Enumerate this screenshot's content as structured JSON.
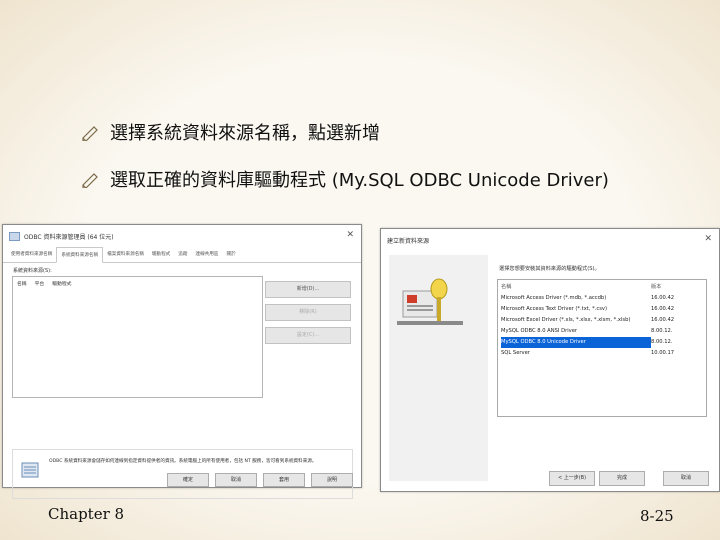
{
  "slide": {
    "bullets": [
      "選擇系統資料來源名稱，點選新增",
      "選取正確的資料庫驅動程式 (My.SQL ODBC Unicode Driver)"
    ],
    "footer_left": "Chapter 8",
    "footer_right": "8-25"
  },
  "odbc_admin_window": {
    "title": "ODBC 資料來源管理員 (64 位元)",
    "tabs": [
      "使用者資料來源名稱",
      "系統資料來源名稱",
      "檔案資料來源名稱",
      "驅動程式",
      "追蹤",
      "連線共用區",
      "關於"
    ],
    "active_tab_index": 1,
    "list_label": "系統資料來源(S):",
    "list_columns": [
      "名稱",
      "平台",
      "驅動程式"
    ],
    "buttons": {
      "add": "新增(D)...",
      "remove": "移除(R)",
      "configure": "設定(C)..."
    },
    "info_text": "ODBC 系統資料來源會儲存如何連線到指定資料提供者的資訊。系統電腦上的所有使用者，包括 NT 服務，皆可看到系統資料來源。",
    "footer_buttons": [
      "確定",
      "取消",
      "套用",
      "說明"
    ]
  },
  "new_datasource_dialog": {
    "title": "建立新資料來源",
    "prompt": "選擇您想要安裝其資料來源的驅動程式(S)。",
    "columns": [
      "名稱",
      "版本"
    ],
    "drivers": [
      {
        "name": "Microsoft Access Driver (*.mdb, *.accdb)",
        "version": "16.00.42"
      },
      {
        "name": "Microsoft Access Text Driver (*.txt, *.csv)",
        "version": "16.00.42"
      },
      {
        "name": "Microsoft Excel Driver (*.xls, *.xlsx, *.xlsm, *.xlsb)",
        "version": "16.00.42"
      },
      {
        "name": "MySQL ODBC 8.0 ANSI Driver",
        "version": "8.00.12."
      },
      {
        "name": "MySQL ODBC 8.0 Unicode Driver",
        "version": "8.00.12."
      },
      {
        "name": "SQL Server",
        "version": "10.00.17"
      }
    ],
    "selected_driver_index": 4,
    "buttons": {
      "back": "< 上一步(B)",
      "finish": "完成",
      "cancel": "取消"
    }
  },
  "colors": {
    "selection": "#0a64d8",
    "background": "#f6f0e4"
  }
}
